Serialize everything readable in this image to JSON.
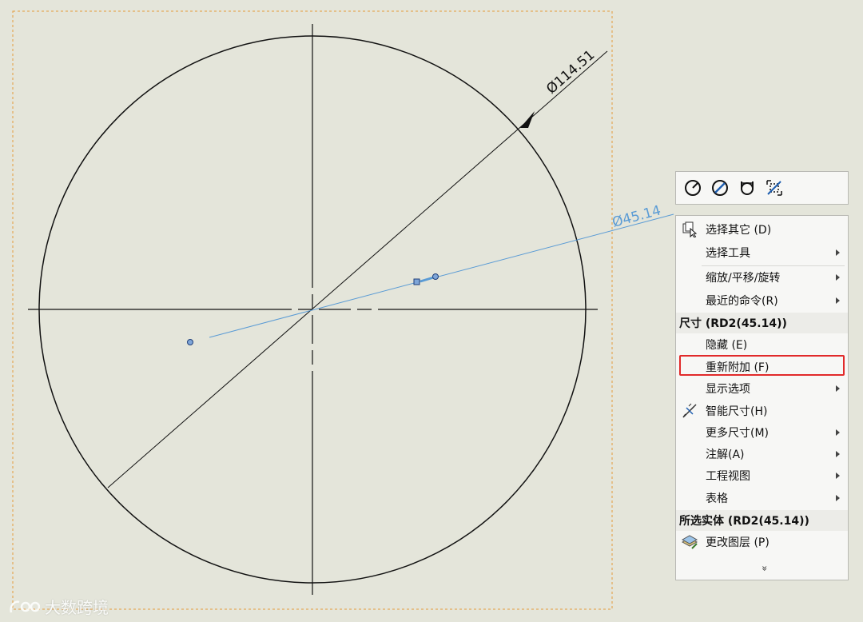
{
  "drawing": {
    "large_dimension": "Ø114.51",
    "small_dimension": "Ø45.14"
  },
  "toolbar": {
    "icons": [
      "radius-dimension-icon",
      "diameter-dimension-icon",
      "linear-diameter-icon",
      "fit-dimension-icon"
    ]
  },
  "menu": {
    "items": [
      {
        "label": "选择其它 (D)",
        "icon": "select-other-icon"
      },
      {
        "label": "选择工具",
        "submenu": true
      },
      {
        "label": "缩放/平移/旋转",
        "submenu": true
      },
      {
        "label": "最近的命令(R)",
        "submenu": true
      }
    ],
    "section_dimension": "尺寸 (RD2(45.14))",
    "dim_items": [
      {
        "label": "隐藏 (E)"
      },
      {
        "label": "重新附加 (F)",
        "highlighted": true
      },
      {
        "label": "显示选项",
        "submenu": true
      },
      {
        "label": "智能尺寸(H)",
        "icon": "smart-dimension-icon"
      },
      {
        "label": "更多尺寸(M)",
        "submenu": true
      },
      {
        "label": "注解(A)",
        "submenu": true
      },
      {
        "label": "工程视图",
        "submenu": true
      },
      {
        "label": "表格",
        "submenu": true
      }
    ],
    "section_selected": "所选实体 (RD2(45.14))",
    "sel_items": [
      {
        "label": "更改图层 (P)",
        "icon": "layer-icon"
      }
    ],
    "more_label": "»"
  },
  "colors": {
    "background": "#e4e5da",
    "highlight_border": "#e12a2a",
    "selected_dimension": "#5a9bd5"
  },
  "watermark": {
    "text": "大数跨境"
  }
}
